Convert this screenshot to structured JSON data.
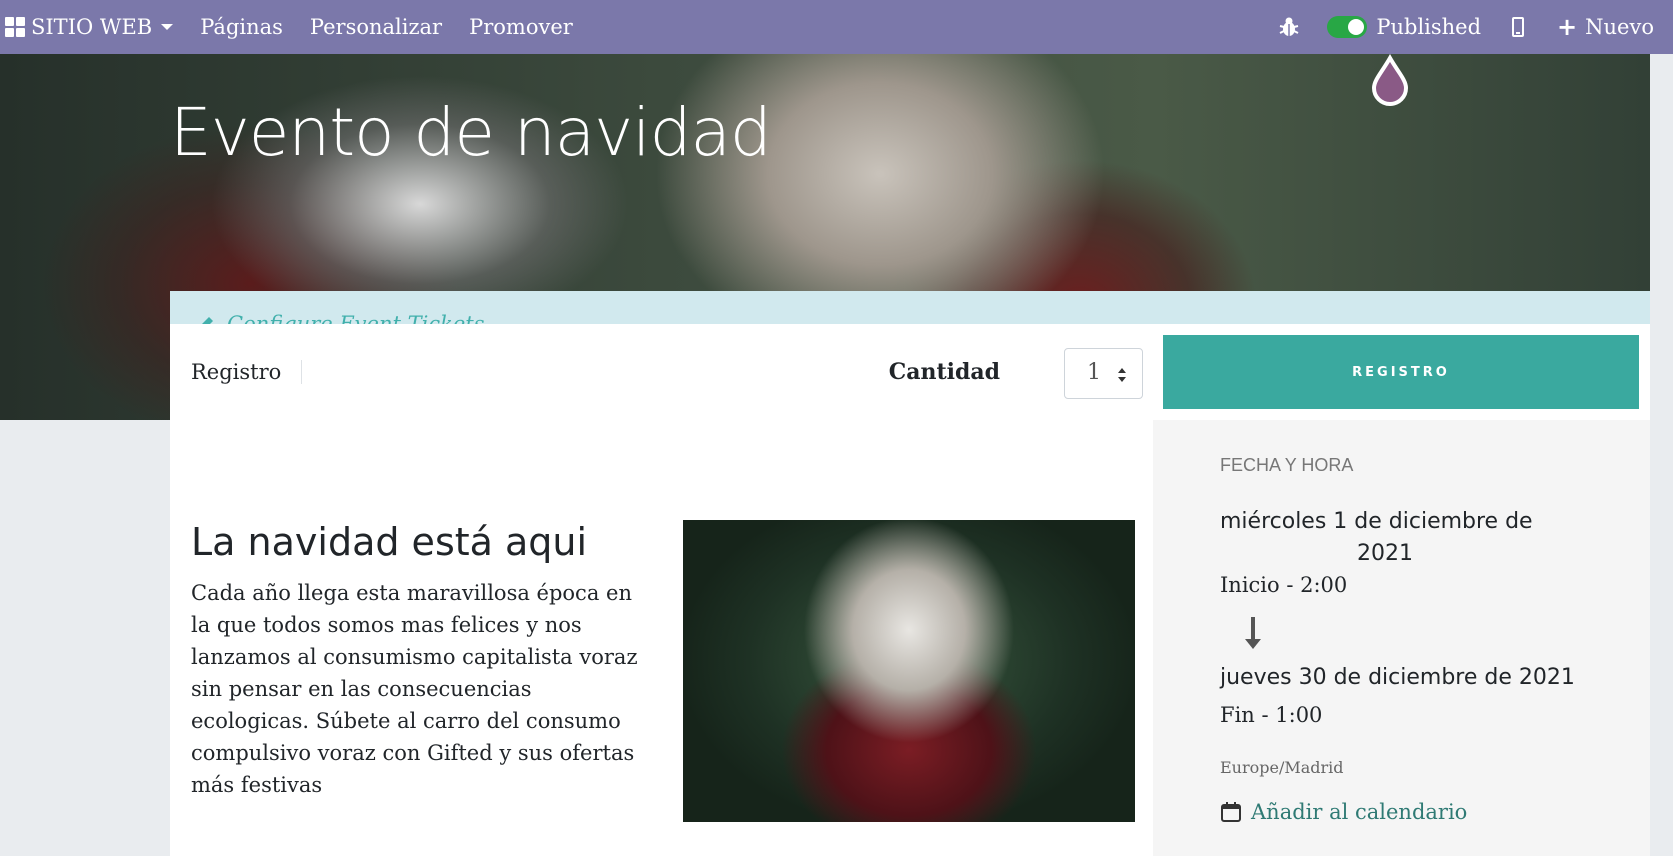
{
  "topbar": {
    "brand": "SITIO WEB",
    "menu": [
      "Páginas",
      "Personalizar",
      "Promover"
    ],
    "published_label": "Published",
    "new_label": "Nuevo"
  },
  "hero": {
    "title": "Evento de navidad",
    "configure_tickets": "Configure Event Tickets"
  },
  "registration": {
    "label": "Registro",
    "quantity_label": "Cantidad",
    "quantity_value": "1",
    "button": "REGISTRO"
  },
  "content": {
    "title": "La navidad está aqui",
    "text": "Cada año llega esta maravillosa época en la que todos somos mas felices y nos lanzamos al consumismo capitalista voraz sin pensar en las consecuencias ecologicas. Súbete al carro del consumo compulsivo voraz con Gifted y sus ofertas más festivas"
  },
  "schedule": {
    "label": "FECHA Y HORA",
    "start_date_line1": "miércoles 1 de diciembre de",
    "start_date_line2": "2021",
    "start_time": "Inicio - 2:00",
    "end_date": "jueves 30 de diciembre de 2021",
    "end_time": "Fin - 1:00",
    "timezone": "Europe/Madrid",
    "add_calendar": "Añadir al calendario"
  },
  "colors": {
    "topbar": "#7b78aa",
    "primary": "#3aa99f",
    "tickets_bar": "#d1e9ee"
  }
}
